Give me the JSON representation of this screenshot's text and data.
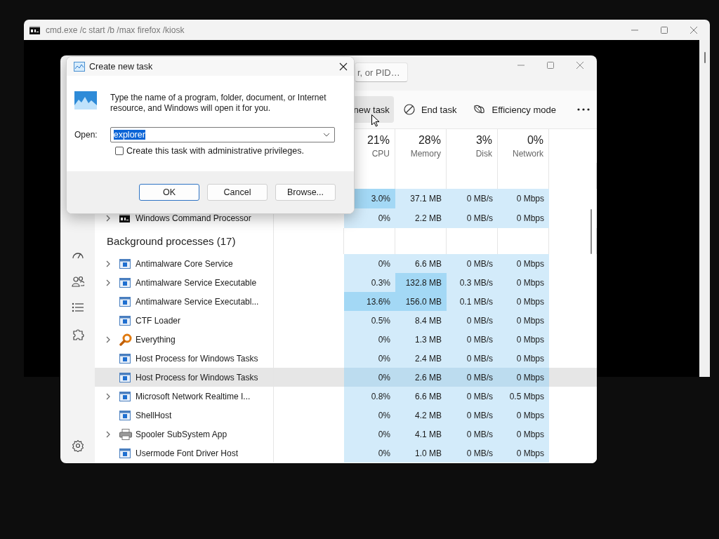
{
  "console_window": {
    "title": "cmd.exe /c start /b /max firefox /kiosk"
  },
  "task_manager": {
    "search": {
      "placeholder": "r, or PID…"
    },
    "toolbar": [
      {
        "kind": "run",
        "label": "new task",
        "hovered": true
      },
      {
        "kind": "end",
        "label": "End task",
        "hovered": false
      },
      {
        "kind": "efficiency",
        "label": "Efficiency mode",
        "hovered": false
      },
      {
        "kind": "more",
        "hovered": false
      }
    ],
    "nav": [
      {
        "kind": "startup"
      },
      {
        "kind": "users"
      },
      {
        "kind": "details"
      },
      {
        "kind": "services"
      },
      {
        "kind": "settings"
      }
    ],
    "columns": [
      {
        "percent": "21%",
        "label": "CPU"
      },
      {
        "percent": "28%",
        "label": "Memory"
      },
      {
        "percent": "3%",
        "label": "Disk"
      },
      {
        "percent": "0%",
        "label": "Network"
      }
    ],
    "rows": [
      {
        "kind": "group",
        "hovered": false
      },
      {
        "kind": "process",
        "hovered": false,
        "values": [
          "3.0%",
          "37.1 MB",
          "0 MB/s",
          "0 Mbps"
        ],
        "hot": [
          true,
          false,
          false,
          false
        ]
      },
      {
        "kind": "console",
        "hovered": false,
        "expandable": true,
        "name": "Windows Command Processor",
        "values": [
          "0%",
          "2.2 MB",
          "0 MB/s",
          "0 Mbps"
        ],
        "hot": [
          false,
          false,
          false,
          false
        ]
      },
      {
        "kind": "group",
        "hovered": false,
        "title": "Background processes (17)"
      },
      {
        "kind": "app",
        "hovered": false,
        "expandable": true,
        "name": "Antimalware Core Service",
        "values": [
          "0%",
          "6.6 MB",
          "0 MB/s",
          "0 Mbps"
        ],
        "hot": [
          false,
          false,
          false,
          false
        ]
      },
      {
        "kind": "app",
        "hovered": false,
        "expandable": true,
        "name": "Antimalware Service Executable",
        "values": [
          "0.3%",
          "132.8 MB",
          "0.3 MB/s",
          "0 Mbps"
        ],
        "hot": [
          false,
          true,
          false,
          false
        ]
      },
      {
        "kind": "app",
        "hovered": false,
        "expandable": false,
        "name": "Antimalware Service Executabl...",
        "values": [
          "13.6%",
          "156.0 MB",
          "0.1 MB/s",
          "0 Mbps"
        ],
        "hot": [
          true,
          true,
          false,
          false
        ]
      },
      {
        "kind": "app",
        "hovered": false,
        "expandable": false,
        "name": "CTF Loader",
        "values": [
          "0.5%",
          "8.4 MB",
          "0 MB/s",
          "0 Mbps"
        ],
        "hot": [
          false,
          false,
          false,
          false
        ]
      },
      {
        "kind": "search",
        "hovered": false,
        "expandable": true,
        "name": "Everything",
        "values": [
          "0%",
          "1.3 MB",
          "0 MB/s",
          "0 Mbps"
        ],
        "hot": [
          false,
          false,
          false,
          false
        ]
      },
      {
        "kind": "app",
        "hovered": false,
        "expandable": false,
        "name": "Host Process for Windows Tasks",
        "values": [
          "0%",
          "2.4 MB",
          "0 MB/s",
          "0 Mbps"
        ],
        "hot": [
          false,
          false,
          false,
          false
        ]
      },
      {
        "kind": "app",
        "hovered": true,
        "expandable": false,
        "name": "Host Process for Windows Tasks",
        "values": [
          "0%",
          "2.6 MB",
          "0 MB/s",
          "0 Mbps"
        ],
        "hot": [
          false,
          false,
          false,
          false
        ]
      },
      {
        "kind": "app",
        "hovered": false,
        "expandable": true,
        "name": "Microsoft Network Realtime I...",
        "values": [
          "0.8%",
          "6.6 MB",
          "0 MB/s",
          "0.5 Mbps"
        ],
        "hot": [
          false,
          false,
          false,
          false
        ]
      },
      {
        "kind": "app",
        "hovered": false,
        "expandable": false,
        "name": "ShellHost",
        "values": [
          "0%",
          "4.2 MB",
          "0 MB/s",
          "0 Mbps"
        ],
        "hot": [
          false,
          false,
          false,
          false
        ]
      },
      {
        "kind": "printer",
        "hovered": false,
        "expandable": true,
        "name": "Spooler SubSystem App",
        "values": [
          "0%",
          "4.1 MB",
          "0 MB/s",
          "0 Mbps"
        ],
        "hot": [
          false,
          false,
          false,
          false
        ]
      },
      {
        "kind": "app",
        "hovered": false,
        "expandable": false,
        "name": "Usermode Font Driver Host",
        "values": [
          "0%",
          "1.0 MB",
          "0 MB/s",
          "0 Mbps"
        ],
        "hot": [
          false,
          false,
          false,
          false
        ]
      }
    ]
  },
  "run_dialog": {
    "title": "Create new task",
    "message": "Type the name of a program, folder, document, or Internet resource, and Windows will open it for you.",
    "open_label": "Open:",
    "open_value": "explorer",
    "admin_checkbox": {
      "label": "Create this task with administrative privileges.",
      "checked": false
    },
    "buttons": [
      {
        "label": "OK",
        "default": true
      },
      {
        "label": "Cancel",
        "default": false
      },
      {
        "label": "Browse...",
        "default": false
      }
    ]
  }
}
